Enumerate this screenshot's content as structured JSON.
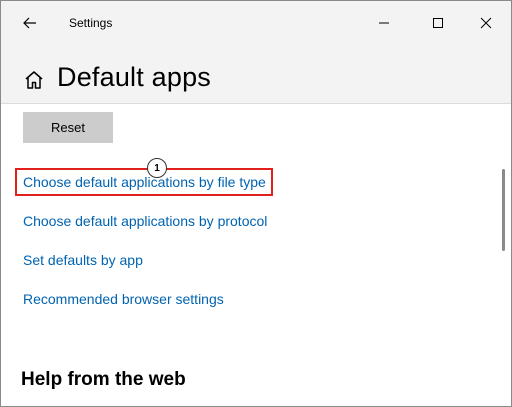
{
  "window": {
    "title": "Settings",
    "controls": {
      "back": "back-arrow-icon",
      "minimize": "minimize-icon",
      "maximize": "maximize-icon",
      "close": "close-icon"
    }
  },
  "header": {
    "home_icon": "home-icon",
    "title": "Default apps"
  },
  "content": {
    "reset_label": "Reset",
    "links": [
      "Choose default applications by file type",
      "Choose default applications by protocol",
      "Set defaults by app",
      "Recommended browser settings"
    ],
    "annotation": {
      "step_number": "1",
      "highlight_color": "#e0201b"
    },
    "section_title": "Help from the web"
  },
  "colors": {
    "link": "#0063b1",
    "titlebar_bg": "#f3f3f3",
    "button_bg": "#cccccc"
  }
}
